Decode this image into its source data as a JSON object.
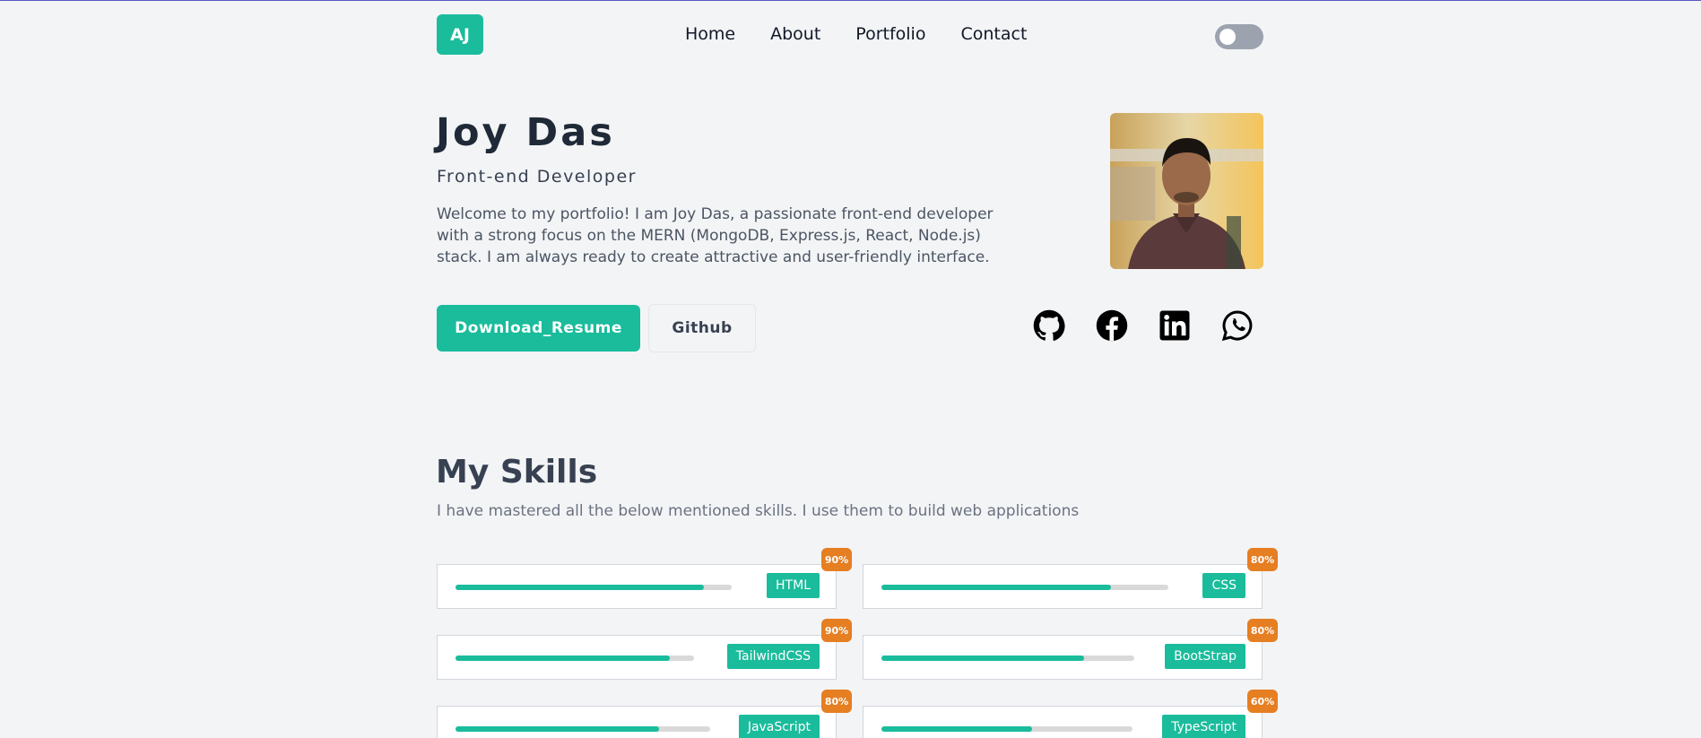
{
  "nav": {
    "logo": "AJ",
    "links": [
      "Home",
      "About",
      "Portfolio",
      "Contact"
    ]
  },
  "hero": {
    "name": "Joy Das",
    "role": "Front-end Developer",
    "description": "Welcome to my portfolio! I am Joy Das, a passionate front-end developer with a strong focus on the MERN (MongoDB, Express.js, React, Node.js) stack. I am always ready to create attractive and user-friendly interface.",
    "primary_button": "Download_Resume",
    "secondary_button": "Github",
    "socials": [
      "github-icon",
      "facebook-icon",
      "linkedin-icon",
      "whatsapp-icon"
    ]
  },
  "skills": {
    "title": "My Skills",
    "subtitle": "I have mastered all the below mentioned skills. I use them to build web applications",
    "items": [
      {
        "name": "HTML",
        "percent_label": "90%",
        "level": 0.9
      },
      {
        "name": "CSS",
        "percent_label": "80%",
        "level": 0.8
      },
      {
        "name": "TailwindCSS",
        "percent_label": "90%",
        "level": 0.9
      },
      {
        "name": "BootStrap",
        "percent_label": "80%",
        "level": 0.8
      },
      {
        "name": "JavaScript",
        "percent_label": "80%",
        "level": 0.8
      },
      {
        "name": "TypeScript",
        "percent_label": "60%",
        "level": 0.6
      }
    ]
  },
  "colors": {
    "accent": "#1abc9c",
    "badge": "#e67e22",
    "background": "#f3f4f6"
  }
}
